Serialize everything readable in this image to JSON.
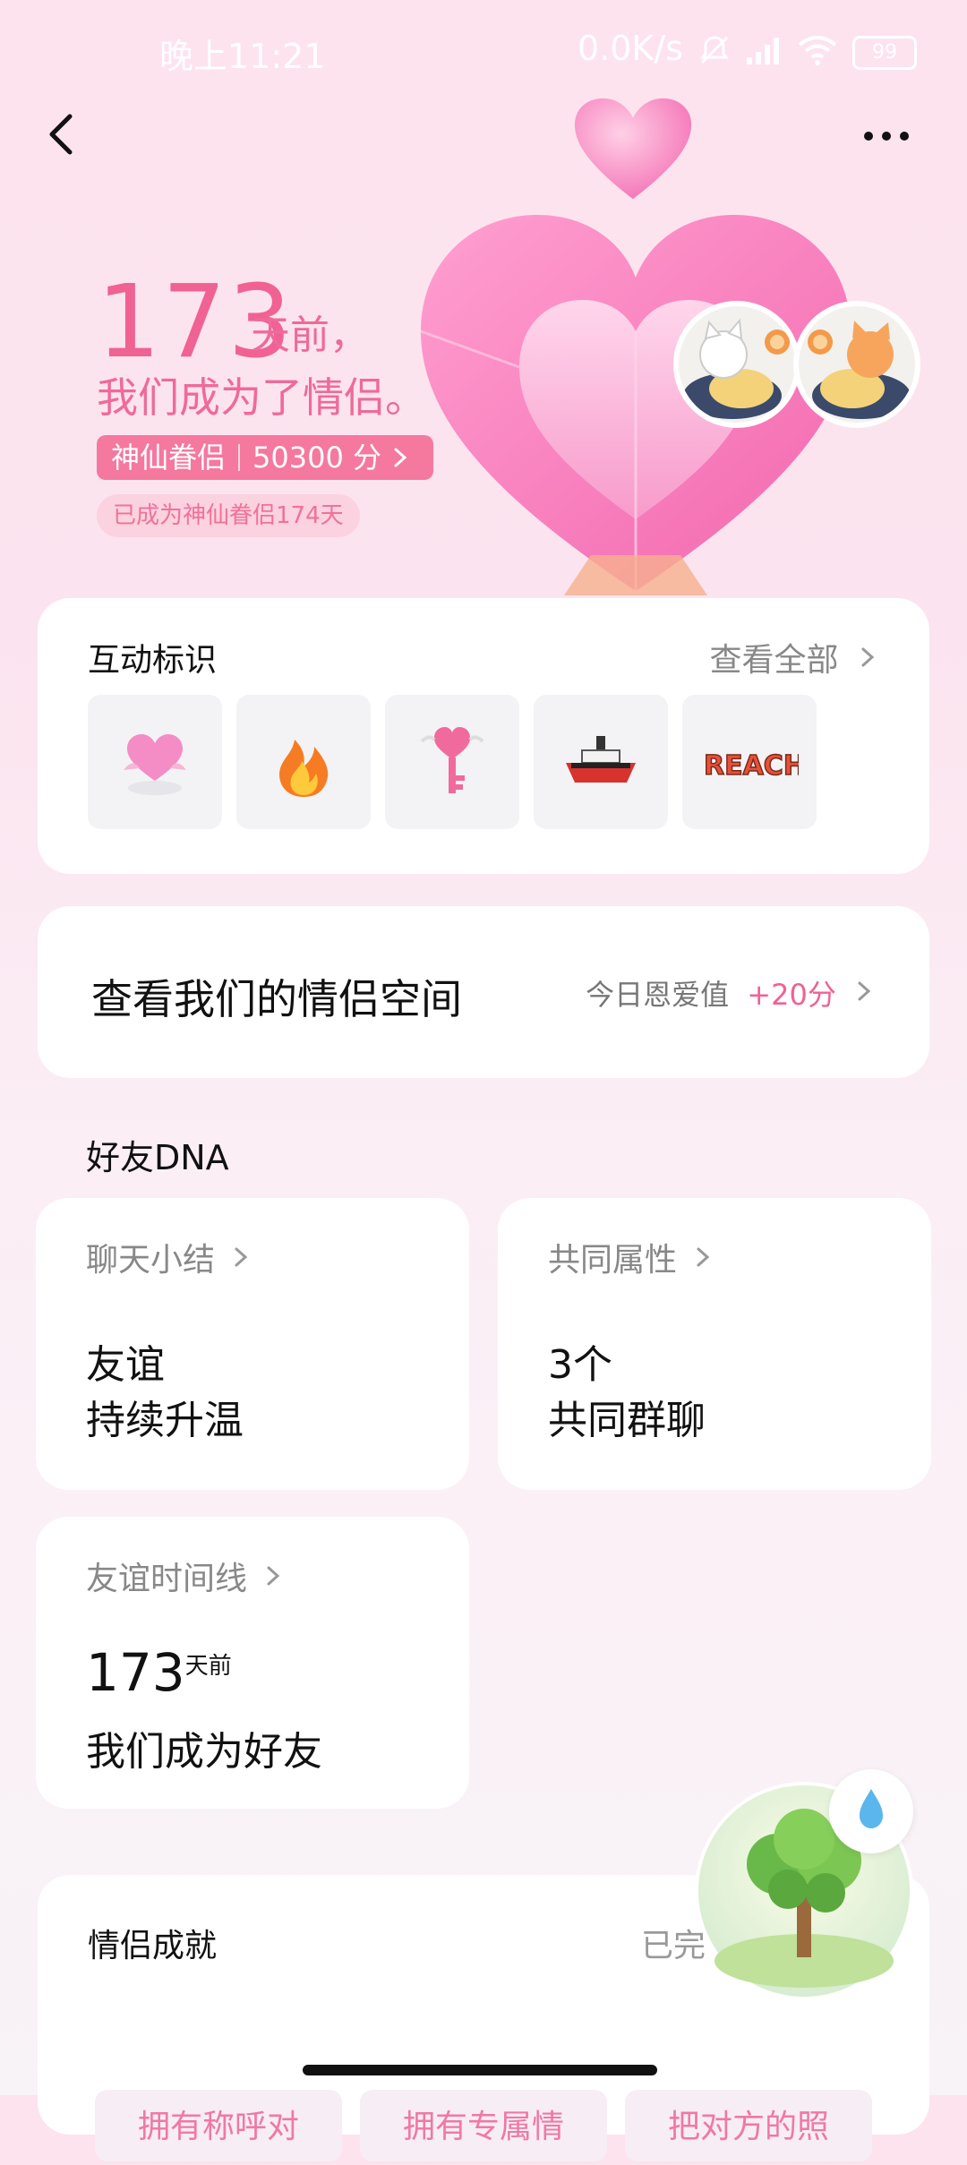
{
  "status_bar": {
    "time": "晚上11:21",
    "net_speed": "0.0K/s",
    "battery": "99"
  },
  "hero": {
    "days": "173",
    "days_suffix": "天前，",
    "line2": "我们成为了情侣。",
    "chip_level": "神仙眷侣",
    "chip_score": "50300 分",
    "chip_note": "已成为神仙眷侣174天"
  },
  "interaction": {
    "title": "互动标识",
    "view_all": "查看全部",
    "badges": [
      {
        "icon": "crystal-heart-icon"
      },
      {
        "icon": "flame-icon"
      },
      {
        "icon": "heart-key-icon"
      },
      {
        "icon": "ship-icon"
      },
      {
        "icon": "reach-icon",
        "label": "REACH"
      }
    ]
  },
  "space": {
    "title": "查看我们的情侣空间",
    "today_label": "今日恩爱值",
    "today_points": "+20分"
  },
  "dna": {
    "title": "好友DNA",
    "chat_summary": {
      "title": "聊天小结",
      "line1": "友谊",
      "line2": "持续升温"
    },
    "common": {
      "title": "共同属性",
      "line1": "3个",
      "line2": "共同群聊"
    },
    "timeline": {
      "title": "友谊时间线",
      "days": "173",
      "days_suffix": "天前",
      "line2": "我们成为好友"
    }
  },
  "achievements": {
    "title": "情侣成就",
    "done_label": "已完",
    "items": [
      "拥有称呼对",
      "拥有专属情",
      "把对方的照"
    ]
  },
  "colors": {
    "accent": "#f06292",
    "chip": "#f5789e",
    "card": "#ffffff"
  }
}
